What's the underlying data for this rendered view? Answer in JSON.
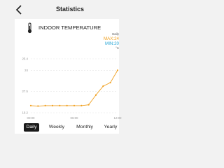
{
  "header": {
    "title": "Statistics",
    "back_icon": "back-chevron-icon"
  },
  "card": {
    "title": "INDOOR TEMPERATURE",
    "icon": "thermometer-icon",
    "legend": {
      "title": "Daily",
      "max": "MAX:24",
      "min": "MIN:20",
      "unit": "°C"
    }
  },
  "chart_data": {
    "type": "line",
    "x": [
      "00:00",
      "01:00",
      "02:00",
      "03:00",
      "04:00",
      "05:00",
      "06:00",
      "07:00",
      "08:00",
      "09:00",
      "10:00",
      "11:00",
      "12:00"
    ],
    "y": [
      20.0,
      19.95,
      20.0,
      20.0,
      20.0,
      20.0,
      20.0,
      20.0,
      20.1,
      21.2,
      22.2,
      22.6,
      24.0
    ],
    "ylim": [
      19.2,
      25.3
    ],
    "yticks": [
      "25.4",
      "24",
      "27.5",
      "19.2"
    ],
    "yticks_values": [
      25.3,
      24.0,
      21.6,
      19.2
    ],
    "xticks": [
      "00:00",
      "06:00",
      "12:00"
    ],
    "xticks_values": [
      "00:00",
      "06:00",
      "12:00"
    ],
    "grid": true,
    "colors": {
      "line": "#f0a020",
      "point": "#f0a020",
      "grid": "#e2e2e2",
      "ticks": "#999999"
    }
  },
  "tabs": [
    {
      "label": "Daily",
      "active": true
    },
    {
      "label": "Weekly",
      "active": false
    },
    {
      "label": "Monthly",
      "active": false
    },
    {
      "label": "Yearly",
      "active": false
    }
  ]
}
